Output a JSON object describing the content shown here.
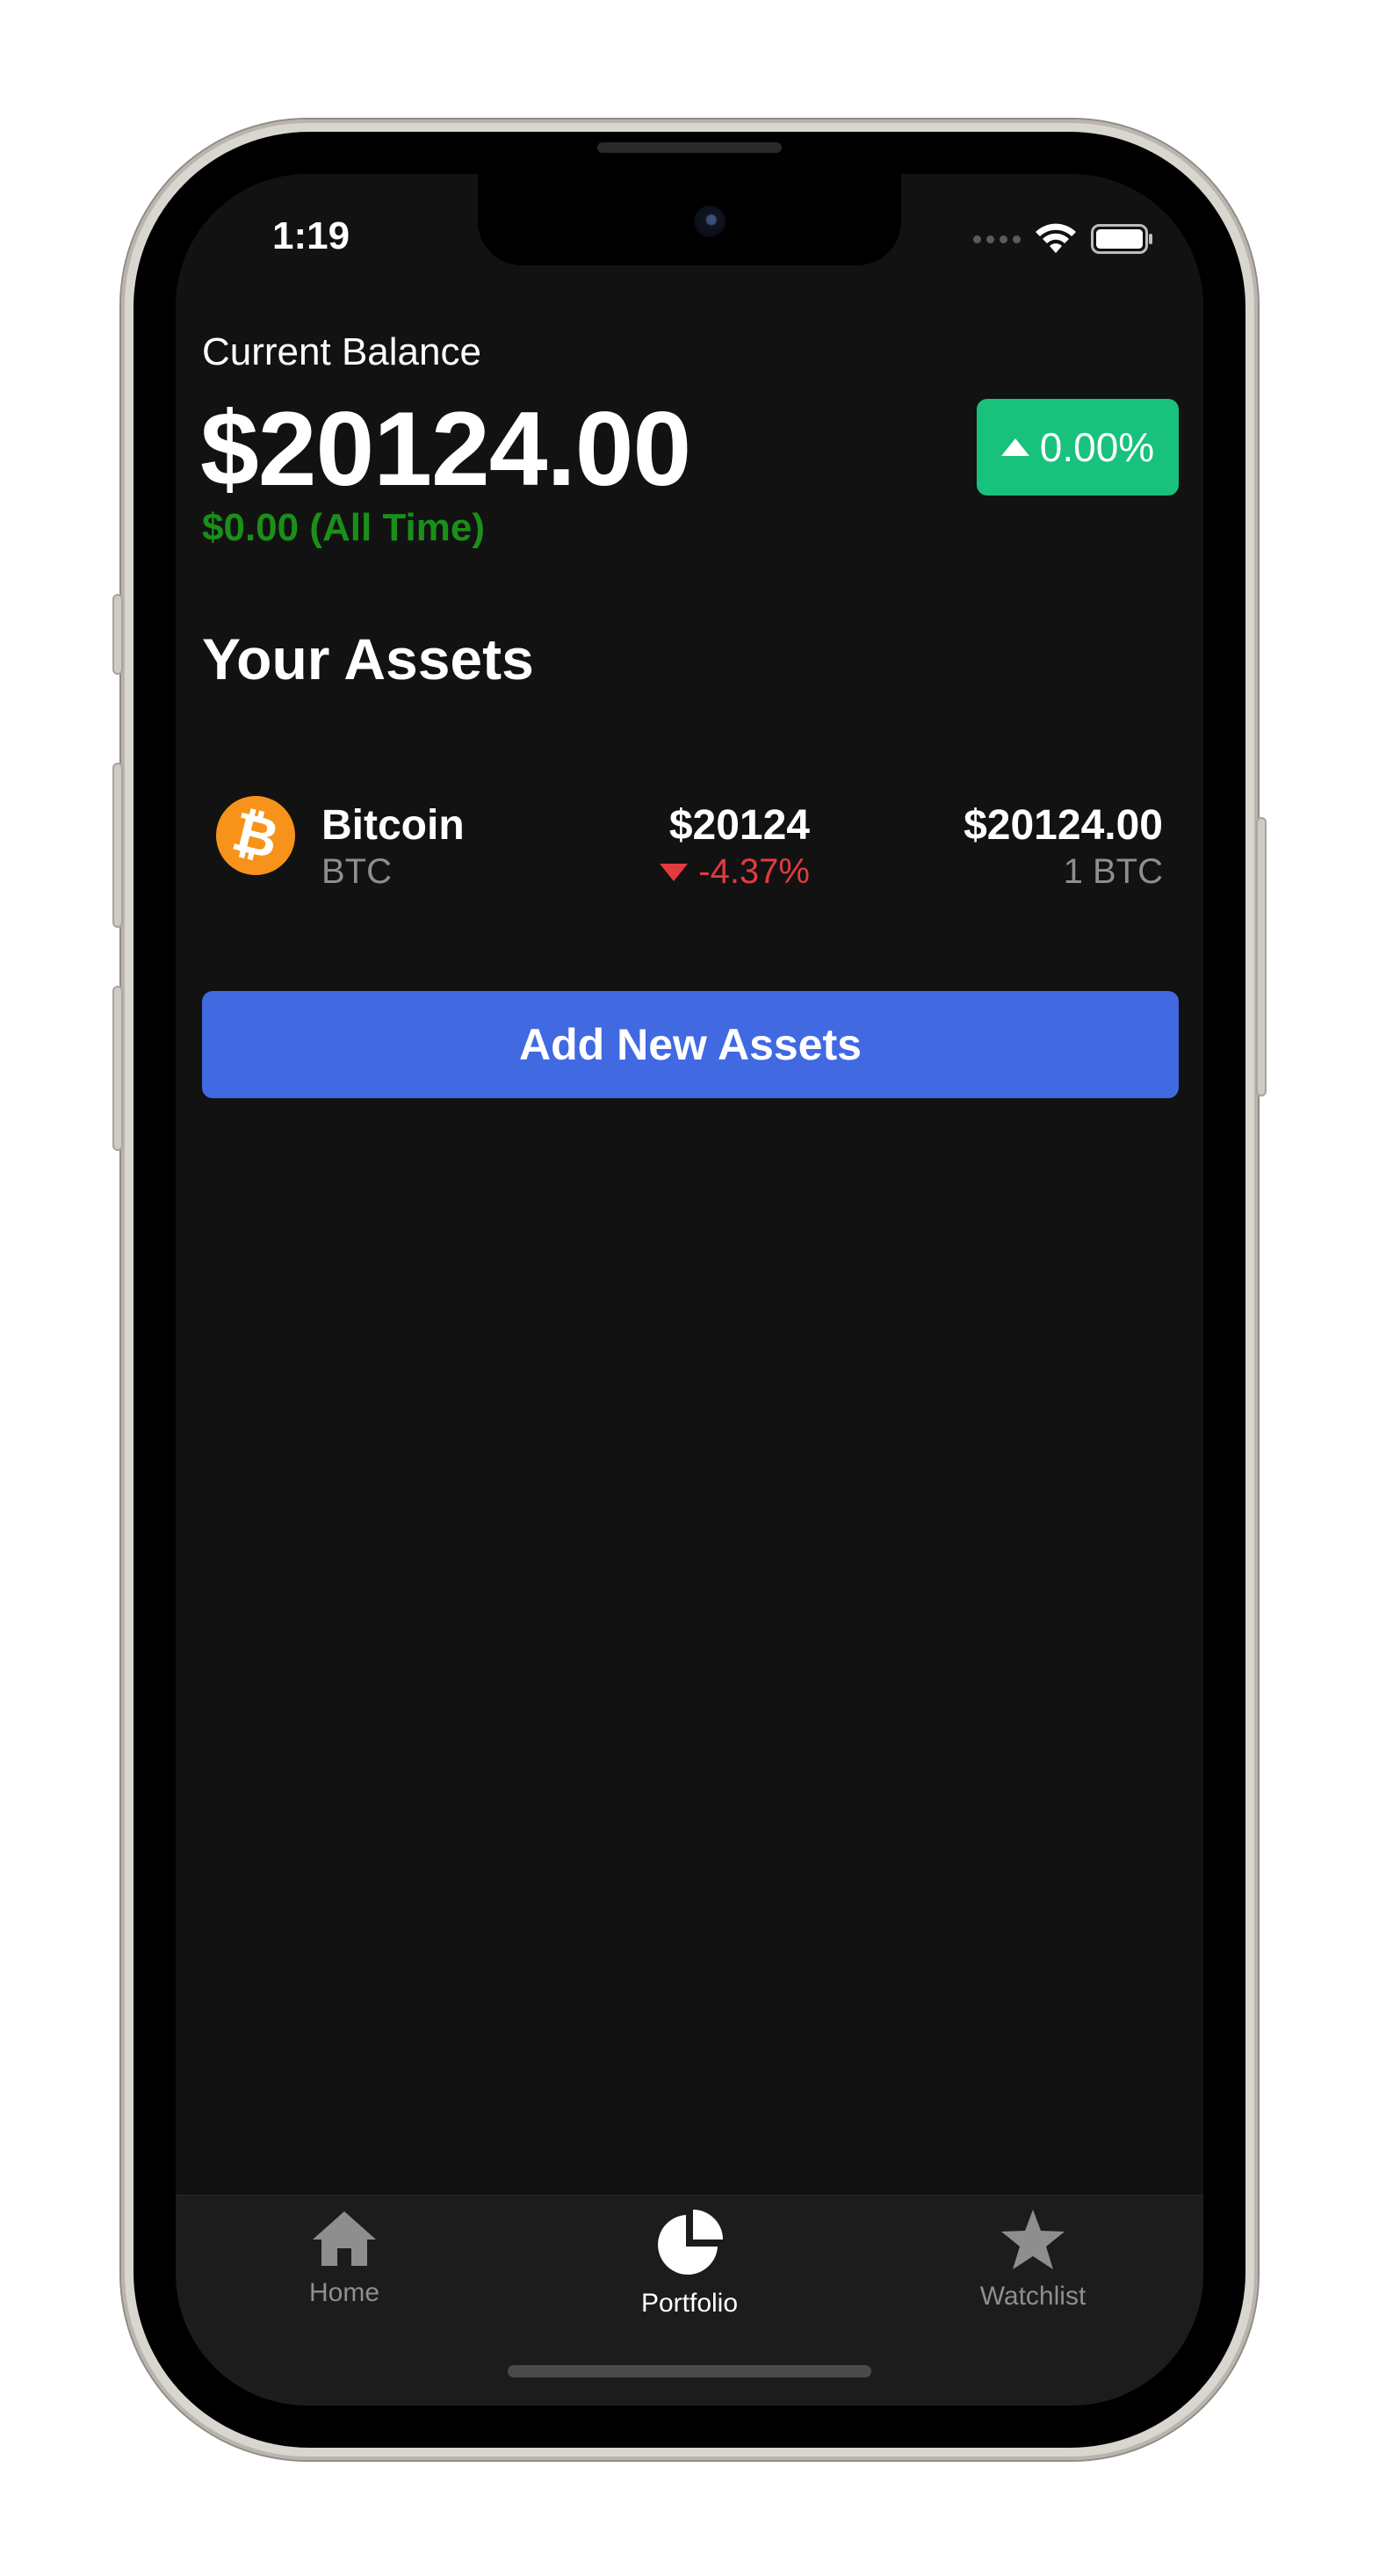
{
  "status_bar": {
    "time": "1:19"
  },
  "balance": {
    "label": "Current Balance",
    "value": "$20124.00",
    "all_time": "$0.00 (All Time)",
    "change_percent": "0.00%"
  },
  "assets_section": {
    "title": "Your Assets",
    "items": [
      {
        "name": "Bitcoin",
        "symbol": "BTC",
        "logo_glyph": "₿",
        "price": "$20124",
        "change": "-4.37%",
        "holding_value": "$20124.00",
        "holding_qty": "1 BTC"
      }
    ]
  },
  "add_button": {
    "label": "Add New Assets"
  },
  "tabbar": {
    "tabs": [
      {
        "label": "Home",
        "icon": "home-icon",
        "active": false
      },
      {
        "label": "Portfolio",
        "icon": "pie-chart-icon",
        "active": true
      },
      {
        "label": "Watchlist",
        "icon": "star-icon",
        "active": false
      }
    ]
  },
  "colors": {
    "background": "#121212",
    "positive": "#18c27d",
    "negative": "#e23a3f",
    "accent": "#4169e1",
    "bitcoin": "#f7931a"
  }
}
